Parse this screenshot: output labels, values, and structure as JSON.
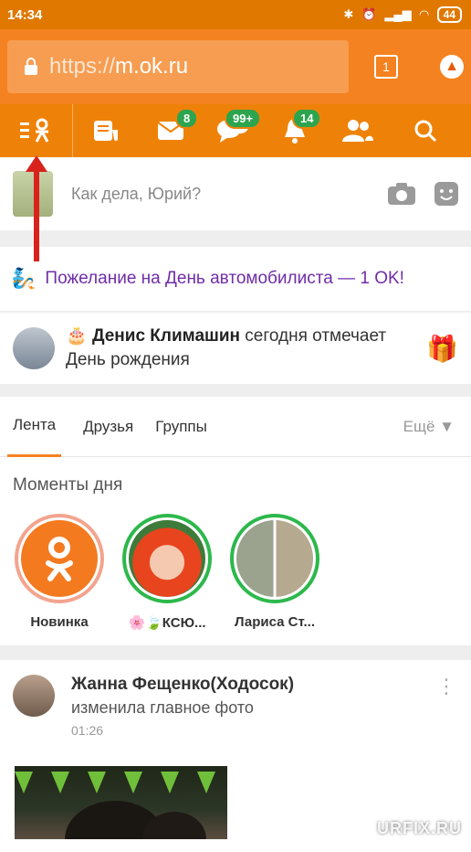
{
  "status_bar": {
    "time": "14:34",
    "battery": "44"
  },
  "browser": {
    "url_proto": "https://",
    "url_host": "m.ok.ru",
    "tab_count": "1"
  },
  "toolbar": {
    "messages_badge": "8",
    "discussions_badge": "99+",
    "notifications_badge": "14"
  },
  "post_box": {
    "placeholder": "Как дела, Юрий?"
  },
  "promo": {
    "text": "Пожелание на День автомобилиста — 1 OK!"
  },
  "birthday": {
    "name": "Денис Климашин",
    "text_after": " сегодня отмечает День рождения"
  },
  "feed_tabs": {
    "tab1": "Лента",
    "tab2": "Друзья",
    "tab3": "Группы",
    "more": "Ещё ▼"
  },
  "moments": {
    "title": "Моменты дня",
    "items": [
      {
        "label": "Новинка"
      },
      {
        "label": "🌸🍃КСЮ..."
      },
      {
        "label": "Лариса Ст..."
      }
    ]
  },
  "post": {
    "author": "Жанна Фещенко(Ходосок)",
    "action": "изменила главное фото",
    "time": "01:26"
  },
  "watermark": "URFIX.RU",
  "colors": {
    "ok_orange": "#ee8208",
    "badge_green": "#2da44e",
    "promo_purple": "#6f2da8"
  }
}
